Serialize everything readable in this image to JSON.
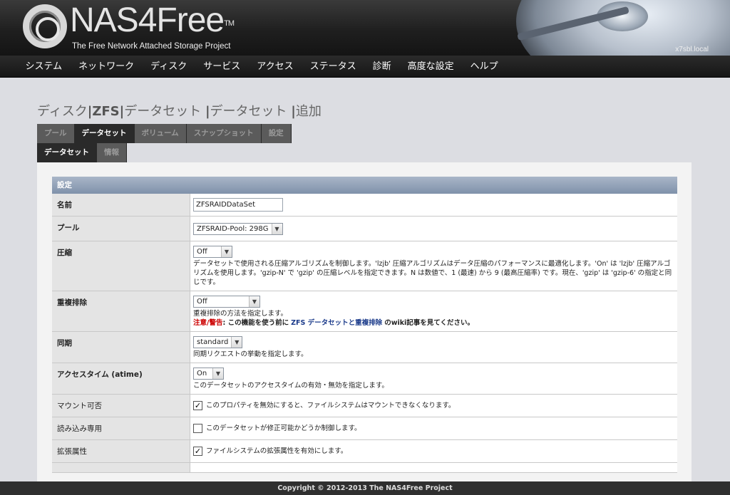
{
  "header": {
    "logo_text": "NAS4Free",
    "tm": "TM",
    "tagline": "The Free Network Attached Storage Project",
    "hostname": "x7sbl.local"
  },
  "nav": [
    "システム",
    "ネットワーク",
    "ディスク",
    "サービス",
    "アクセス",
    "ステータス",
    "診断",
    "高度な設定",
    "ヘルプ"
  ],
  "breadcrumb": {
    "p1": "ディスク",
    "p2": "ZFS",
    "p3": "データセット",
    "p4": "データセット",
    "p5": "追加"
  },
  "tabs_row1": [
    {
      "label": "プール",
      "active": false
    },
    {
      "label": "データセット",
      "active": true
    },
    {
      "label": "ボリューム",
      "active": false
    },
    {
      "label": "スナップショット",
      "active": false
    },
    {
      "label": "設定",
      "active": false
    }
  ],
  "tabs_row2": [
    {
      "label": "データセット",
      "active": true
    },
    {
      "label": "情報",
      "active": false
    }
  ],
  "form": {
    "section_title": "設定",
    "name": {
      "label": "名前",
      "value": "ZFSRAIDDataSet"
    },
    "pool": {
      "label": "プール",
      "selected": "ZFSRAID-Pool: 298G"
    },
    "compression": {
      "label": "圧縮",
      "selected": "Off",
      "description": "データセットで使用される圧縮アルゴリズムを制御します。'lzjb' 圧縮アルゴリズムはデータ圧縮のパフォーマンスに最適化します。'On' は 'lzjb' 圧縮アルゴリズムを使用します。'gzip-N' で 'gzip' の圧縮レベルを指定できます。N は数値で、1 (最速) から 9 (最高圧縮率) です。現在、'gzip' は 'gzip-6' の指定と同じです。"
    },
    "dedup": {
      "label": "重複排除",
      "selected": "Off",
      "description": "重複排除の方法を指定します。",
      "warn_label": "注意/警告",
      "warn_text": ": この機能を使う前に",
      "link_text": "ZFS データセットと重複排除",
      "warn_tail": "のwiki記事を見てください。"
    },
    "sync": {
      "label": "同期",
      "selected": "standard",
      "description": "同期リクエストの挙動を指定します。"
    },
    "atime": {
      "label": "アクセスタイム (atime)",
      "selected": "On",
      "description": "このデータセットのアクセスタイムの有効・無効を指定します。"
    },
    "canmount": {
      "label": "マウント可否",
      "checked": true,
      "text": "このプロパティを無効にすると、ファイルシステムはマウントできなくなります。"
    },
    "readonly": {
      "label": "読み込み専用",
      "checked": false,
      "text": "このデータセットが修正可能かどうか制御します。"
    },
    "xattr": {
      "label": "拡張属性",
      "checked": true,
      "text": "ファイルシステムの拡張属性を有効にします。"
    }
  },
  "footer": "Copyright © 2012-2013 The NAS4Free Project"
}
